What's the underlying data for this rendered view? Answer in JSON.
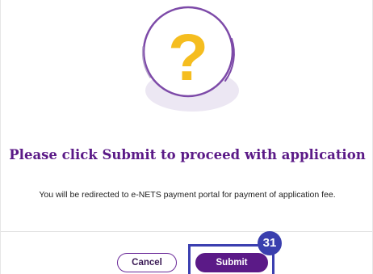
{
  "dialog": {
    "icon": "question-mark-icon",
    "title": "Please click Submit to proceed with application",
    "message": "You will be redirected to e-NETS payment portal for payment of application fee.",
    "cancel_label": "Cancel",
    "submit_label": "Submit"
  },
  "annotation": {
    "step_number": "31"
  },
  "colors": {
    "title": "#5b1a87",
    "primary_button": "#5b1a87",
    "icon_yellow": "#f5bd1f",
    "highlight": "#3b3fb0"
  }
}
